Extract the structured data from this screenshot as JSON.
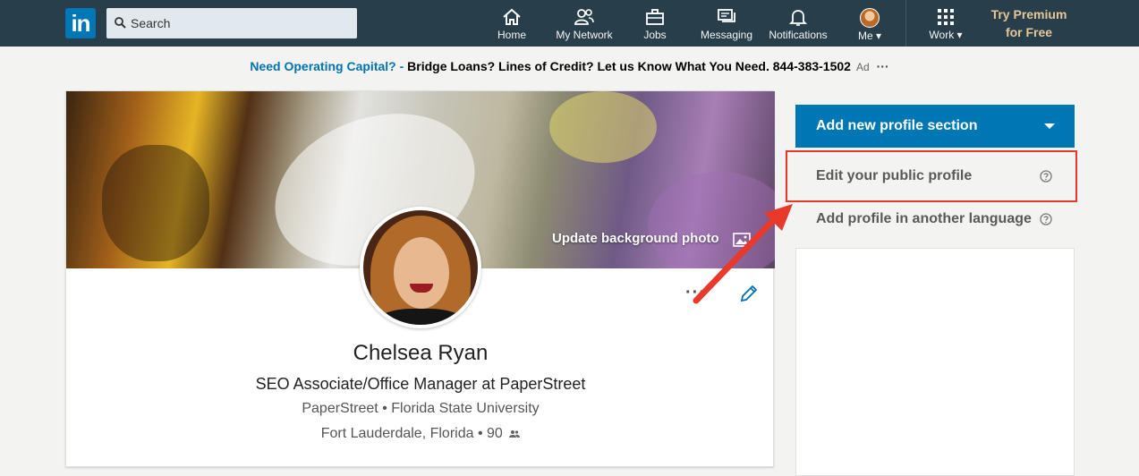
{
  "nav": {
    "logo_text": "in",
    "search_placeholder": "Search",
    "items": [
      {
        "label": "Home",
        "icon": "home-icon"
      },
      {
        "label": "My Network",
        "icon": "people-icon"
      },
      {
        "label": "Jobs",
        "icon": "briefcase-icon"
      },
      {
        "label": "Messaging",
        "icon": "message-icon"
      },
      {
        "label": "Notifications",
        "icon": "bell-icon"
      },
      {
        "label": "Me",
        "icon": "avatar"
      },
      {
        "label": "Work",
        "icon": "grid-icon"
      }
    ],
    "premium_line1": "Try Premium",
    "premium_line2": "for Free"
  },
  "ad": {
    "lead": "Need Operating Capital? - ",
    "text": "Bridge Loans? Lines of Credit? Let us Know What You Need. 844-383-1502",
    "tag": "Ad",
    "more": "···"
  },
  "profile": {
    "update_background": "Update background photo",
    "more": "···",
    "name": "Chelsea Ryan",
    "headline": "SEO Associate/Office Manager at PaperStreet",
    "company": "PaperStreet",
    "school": "Florida State University",
    "location": "Fort Lauderdale, Florida",
    "connections": "90",
    "separator": "•"
  },
  "rail": {
    "add_section": "Add new profile section",
    "edit_public": "Edit your public profile",
    "add_language": "Add profile in another language"
  },
  "colors": {
    "nav_bg": "#283e4a",
    "brand": "#0077b5",
    "highlight": "#e8392a"
  }
}
